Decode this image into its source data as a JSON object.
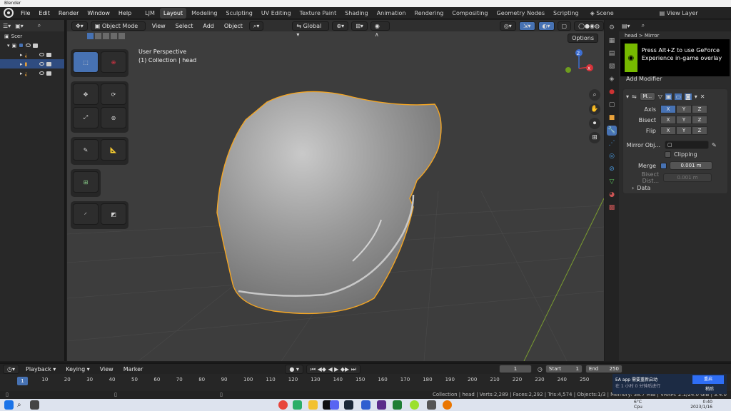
{
  "window": {
    "title": "Blender"
  },
  "menubar": {
    "items": [
      "File",
      "Edit",
      "Render",
      "Window",
      "Help"
    ],
    "workspaces": [
      "LJM",
      "Layout",
      "Modeling",
      "Sculpting",
      "UV Editing",
      "Texture Paint",
      "Shading",
      "Animation",
      "Rendering",
      "Compositing",
      "Geometry Nodes",
      "Scripting"
    ],
    "active_workspace": "Layout",
    "scene": "Scene",
    "view_layer": "View Layer"
  },
  "outliner": {
    "rows": [
      {
        "label": "Scer",
        "selected": false
      },
      {
        "label": "",
        "selected": false
      },
      {
        "label": "",
        "selected": false
      },
      {
        "label": "",
        "selected": true
      },
      {
        "label": "",
        "selected": false
      }
    ]
  },
  "viewport": {
    "mode": "Object Mode",
    "menus": [
      "View",
      "Select",
      "Add",
      "Object"
    ],
    "transform_orientation": "Global",
    "options_label": "Options",
    "overlay_line1": "User Perspective",
    "overlay_line2": "(1) Collection | head",
    "gizmo_axes": [
      "Z",
      "X",
      "Y"
    ]
  },
  "properties": {
    "object_name": "head",
    "modifier_header": "Mirror",
    "add_modifier": "Add Modifier",
    "modifier_name": "M...",
    "axis_label": "Axis",
    "bisect_label": "Bisect",
    "flip_label": "Flip",
    "axes": [
      "X",
      "Y",
      "Z"
    ],
    "axis_on": [
      true,
      false,
      false
    ],
    "bisect_on": [
      false,
      false,
      false
    ],
    "flip_on": [
      false,
      false,
      false
    ],
    "mirror_object_label": "Mirror Obj...",
    "clipping_label": "Clipping",
    "merge_label": "Merge",
    "merge_value": "0.001 m",
    "bisect_distance_label": "Bisect Dist...",
    "bisect_distance_value": "0.001 m",
    "data_label": "Data"
  },
  "overlay_popup": {
    "text": "Press Alt+Z to use GeForce Experience in-game overlay"
  },
  "timeline": {
    "menus": [
      "Playback",
      "Keying",
      "View",
      "Marker"
    ],
    "current_frame": "1",
    "start_label": "Start",
    "start_value": "1",
    "end_label": "End",
    "end_value": "250",
    "ticks": [
      "1",
      "10",
      "20",
      "30",
      "40",
      "50",
      "60",
      "70",
      "80",
      "90",
      "100",
      "110",
      "120",
      "130",
      "140",
      "150",
      "160",
      "170",
      "180",
      "190",
      "200",
      "210",
      "220",
      "230",
      "240",
      "250"
    ]
  },
  "statusbar": {
    "text": "Collection | head | Verts:2,289 | Faces:2,292 | Tris:4,574 | Objects:1/3 | Memory: 38.7 MiB | VRAM: 2.1/24.0 GiB | 3.4.0"
  },
  "notification": {
    "title": "EA app 需要重新启动",
    "body": "在 1 小时 0 分钟后进行",
    "button": "重启",
    "secondary": "稍后"
  },
  "taskbar": {
    "weather": "6°C",
    "weather_sub": "Cpu",
    "time": "0:40",
    "date": "2023/1/16"
  },
  "colors": {
    "accent": "#4772b3",
    "selection_outline": "#f5a623",
    "nvidia": "#76b900"
  }
}
